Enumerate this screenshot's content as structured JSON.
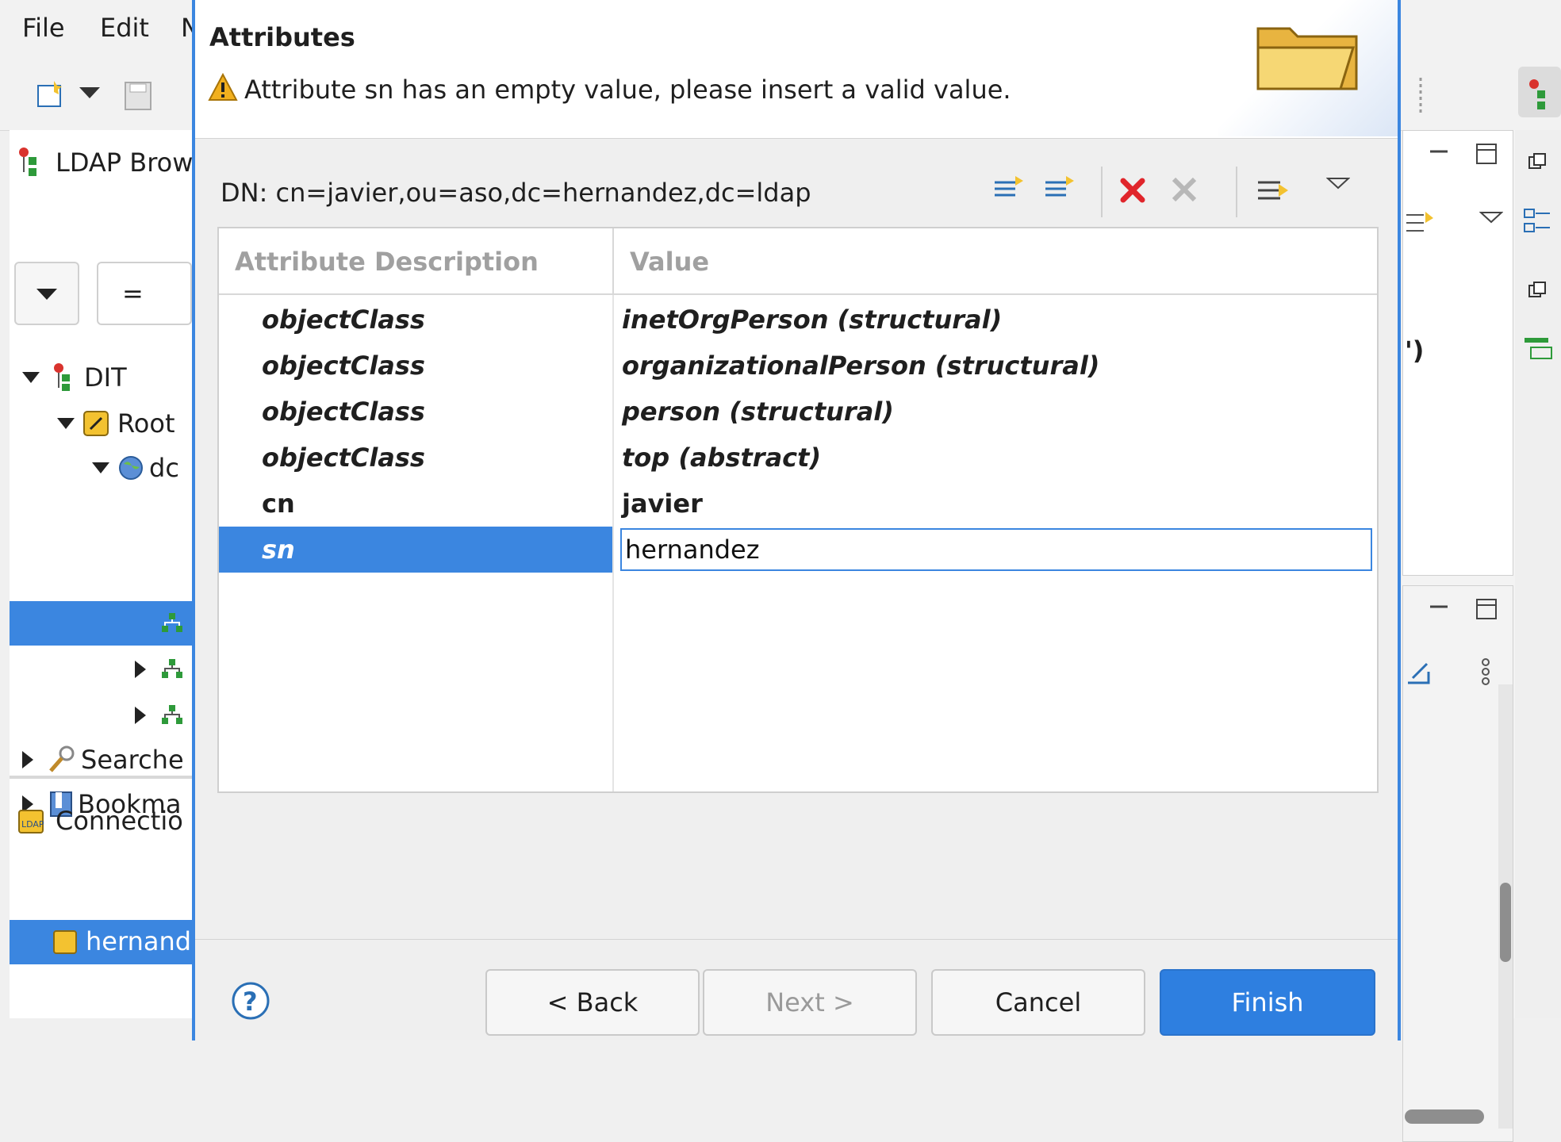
{
  "menu": {
    "file": "File",
    "edit": "Edit",
    "more": "N"
  },
  "left_pane": {
    "view_title": "LDAP Brow",
    "filter_operator": "=",
    "tree": [
      {
        "label": "DIT"
      },
      {
        "label": "Root"
      },
      {
        "label": "dc"
      },
      {
        "label": ""
      },
      {
        "label": ""
      },
      {
        "label": ""
      },
      {
        "label": "Searche"
      },
      {
        "label": "Bookma"
      }
    ],
    "connections_title": "Connectio",
    "connection_item": "hernand"
  },
  "right_pane": {
    "fragment_text": "')"
  },
  "dialog": {
    "title": "Attributes",
    "message": "Attribute sn has an empty value, please insert a valid value.",
    "dn_label": "DN: cn=javier,ou=aso,dc=hernandez,dc=ldap",
    "table": {
      "headers": [
        "Attribute Description",
        "Value"
      ],
      "rows": [
        {
          "description": "objectClass",
          "value": "inetOrgPerson (structural)",
          "italic": true
        },
        {
          "description": "objectClass",
          "value": "organizationalPerson (structural)",
          "italic": true
        },
        {
          "description": "objectClass",
          "value": "person (structural)",
          "italic": true
        },
        {
          "description": "objectClass",
          "value": "top (abstract)",
          "italic": true
        },
        {
          "description": "cn",
          "value": "javier",
          "italic": false
        },
        {
          "description": "sn",
          "value": "hernandez",
          "italic": true,
          "selected": true,
          "editing": true
        }
      ]
    },
    "buttons": {
      "back": "< Back",
      "next": "Next >",
      "cancel": "Cancel",
      "finish": "Finish"
    }
  },
  "colors": {
    "accent": "#3b86e0",
    "delete_red": "#e0252b",
    "warning_yellow": "#f2b01e"
  }
}
